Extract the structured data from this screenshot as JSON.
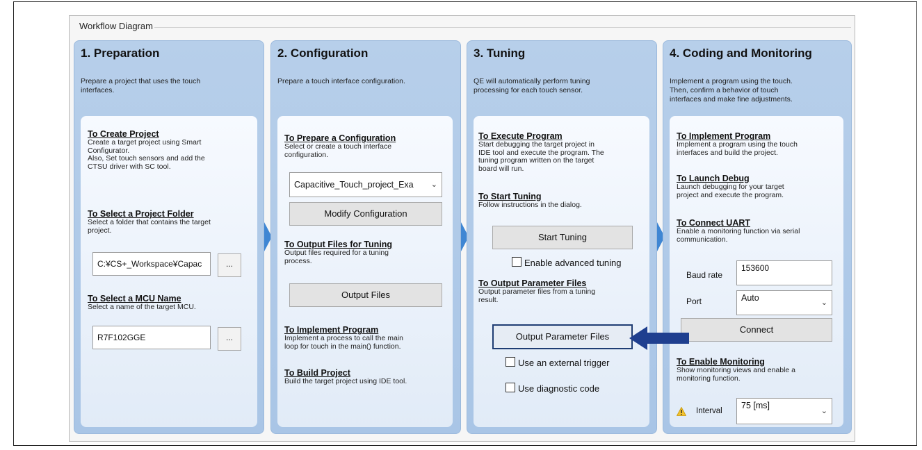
{
  "frame": {
    "title": "Workflow Diagram"
  },
  "columns": {
    "c1": {
      "title": "1. Preparation",
      "desc": "Prepare a project that uses the touch\ninterfaces.",
      "create_project": {
        "heading": "To Create Project",
        "desc": "Create a target project using Smart\nConfigurator.\nAlso, Set touch sensors and add the\nCTSU driver with SC tool."
      },
      "select_folder": {
        "heading": "To Select a Project Folder",
        "desc": "Select a folder that contains the target\nproject.",
        "value": "C:¥CS+_Workspace¥Capac",
        "browse": "..."
      },
      "select_mcu": {
        "heading": "To Select a MCU Name",
        "desc": "Select a name of the target MCU.",
        "value": "R7F102GGE",
        "browse": "..."
      }
    },
    "c2": {
      "title": "2. Configuration",
      "desc": "Prepare a touch interface configuration.",
      "prepare": {
        "heading": "To Prepare a Configuration",
        "desc": "Select or create a touch interface\nconfiguration.",
        "combo_value": "Capacitive_Touch_project_Exa",
        "modify_button": "Modify Configuration"
      },
      "output_tuning": {
        "heading": "To Output Files for Tuning",
        "desc": "Output files required for a tuning\nprocess.",
        "button": "Output Files"
      },
      "implement": {
        "heading": "To Implement Program",
        "desc": "Implement a process to call the main\nloop for touch in the main() function."
      },
      "build": {
        "heading": "To Build Project",
        "desc": "Build the target project using IDE tool."
      }
    },
    "c3": {
      "title": "3. Tuning",
      "desc": "QE will automatically perform tuning\nprocessing for each touch sensor.",
      "execute": {
        "heading": "To Execute Program",
        "desc": "Start debugging the target project in\nIDE tool and execute the program. The\ntuning program written on the target\nboard will run."
      },
      "start": {
        "heading": "To Start Tuning",
        "desc": "Follow instructions in the dialog.",
        "button": "Start Tuning",
        "checkbox": "Enable advanced tuning"
      },
      "output_param": {
        "heading": "To Output Parameter Files",
        "desc": "Output parameter files from a tuning\nresult.",
        "button": "Output Parameter Files",
        "check_trigger": "Use an external trigger",
        "check_diag": "Use diagnostic code"
      }
    },
    "c4": {
      "title": "4. Coding and Monitoring",
      "desc": "Implement a program using the touch.\nThen, confirm a behavior of touch\ninterfaces and make fine adjustments.",
      "implement": {
        "heading": "To Implement Program",
        "desc": "Implement a program using the touch\ninterfaces and build the project."
      },
      "launch": {
        "heading": "To Launch Debug",
        "desc": "Launch debugging for your target\nproject and execute the program."
      },
      "uart": {
        "heading": "To Connect UART",
        "desc": "Enable a monitoring function via serial\ncommunication.",
        "baud_label": "Baud rate",
        "baud_value": "153600",
        "port_label": "Port",
        "port_value": "Auto",
        "connect_button": "Connect"
      },
      "monitoring": {
        "heading": "To Enable Monitoring",
        "desc": "Show monitoring views and enable a\nmonitoring function.",
        "interval_label": "Interval",
        "interval_value": "75 [ms]"
      }
    }
  },
  "icons": {
    "chevron": "chevron-down-icon",
    "warning": "warning-icon",
    "arrow": "arrow-left-icon",
    "step_arrow": "triangle-right-icon"
  },
  "colors": {
    "panel": "#abc7e7",
    "inner_panel": "#eaf1fa",
    "step_arrow": "#3f86d3",
    "callout_arrow": "#1f3f8f"
  }
}
